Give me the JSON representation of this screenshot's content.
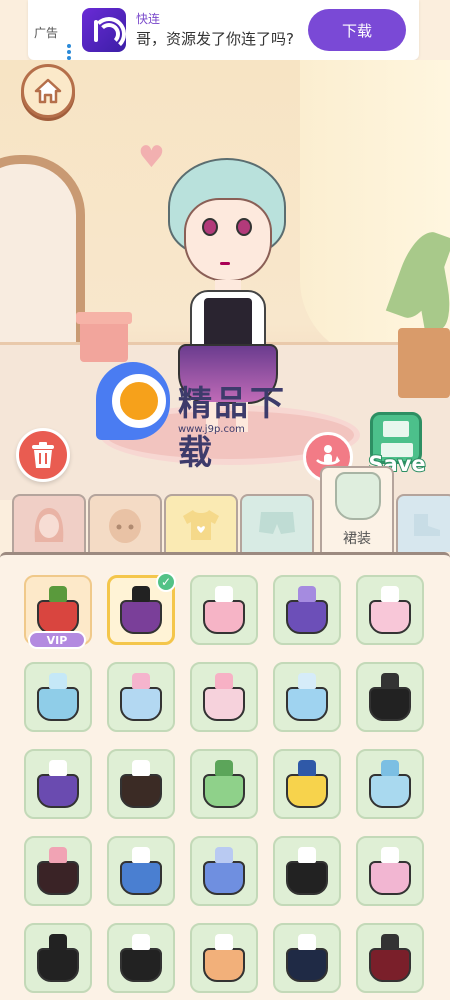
{
  "ad": {
    "tag": "广告",
    "app_name": "快连",
    "description": "哥，资源发了你连了吗?",
    "download_label": "下载"
  },
  "scene": {
    "save_label": "Save"
  },
  "watermark": {
    "title": "精品下载",
    "url": "www.j9p.com"
  },
  "tabs": [
    {
      "icon": "hair-icon",
      "color": "#e9b3a5"
    },
    {
      "icon": "face-icon",
      "color": "#e9c2a5"
    },
    {
      "icon": "top-icon",
      "color": "#f5d98a"
    },
    {
      "icon": "pants-icon",
      "color": "#bfdcd4"
    },
    {
      "icon": "dress-icon",
      "label": "裙装",
      "active": true
    },
    {
      "icon": "shoe-icon",
      "color": "#c8dde6"
    }
  ],
  "items": {
    "vip_label": "VIP",
    "check_mark": "✓",
    "rows": [
      [
        {
          "color": "#d9453f",
          "top": "#5a9a3c",
          "vip": true
        },
        {
          "color": "#7a3f99",
          "top": "#222",
          "selected": true
        },
        {
          "color": "#f6b4c6",
          "top": "#fff"
        },
        {
          "color": "#6c4fb8",
          "top": "#a58be0"
        },
        {
          "color": "#f8c7d8",
          "top": "#fff"
        }
      ],
      [
        {
          "color": "#8fcde8",
          "top": "#c5e8f7"
        },
        {
          "color": "#b3d8f2",
          "top": "#f5b4cd"
        },
        {
          "color": "#f6d2dc",
          "top": "#f7b1c5"
        },
        {
          "color": "#9fd3f0",
          "top": "#d6ecf9"
        },
        {
          "color": "#222",
          "top": "#333"
        }
      ],
      [
        {
          "color": "#6a4bb0",
          "top": "#fff"
        },
        {
          "color": "#3b2b25",
          "top": "#fff"
        },
        {
          "color": "#8fd18a",
          "top": "#5ca55a"
        },
        {
          "color": "#f7d34c",
          "top": "#2f59a8"
        },
        {
          "color": "#a9d9ef",
          "top": "#7cbfe3"
        }
      ],
      [
        {
          "color": "#3a2326",
          "top": "#f1a3b4"
        },
        {
          "color": "#4a7fd1",
          "top": "#fff"
        },
        {
          "color": "#6f8fe0",
          "top": "#b9caf2"
        },
        {
          "color": "#222",
          "top": "#fff"
        },
        {
          "color": "#f2b6d2",
          "top": "#fff"
        }
      ],
      [
        {
          "color": "#222",
          "top": "#222"
        },
        {
          "color": "#222",
          "top": "#fff"
        },
        {
          "color": "#f2b07a",
          "top": "#fff"
        },
        {
          "color": "#1f2a45",
          "top": "#fff"
        },
        {
          "color": "#7a1f2a",
          "top": "#333"
        }
      ]
    ]
  }
}
